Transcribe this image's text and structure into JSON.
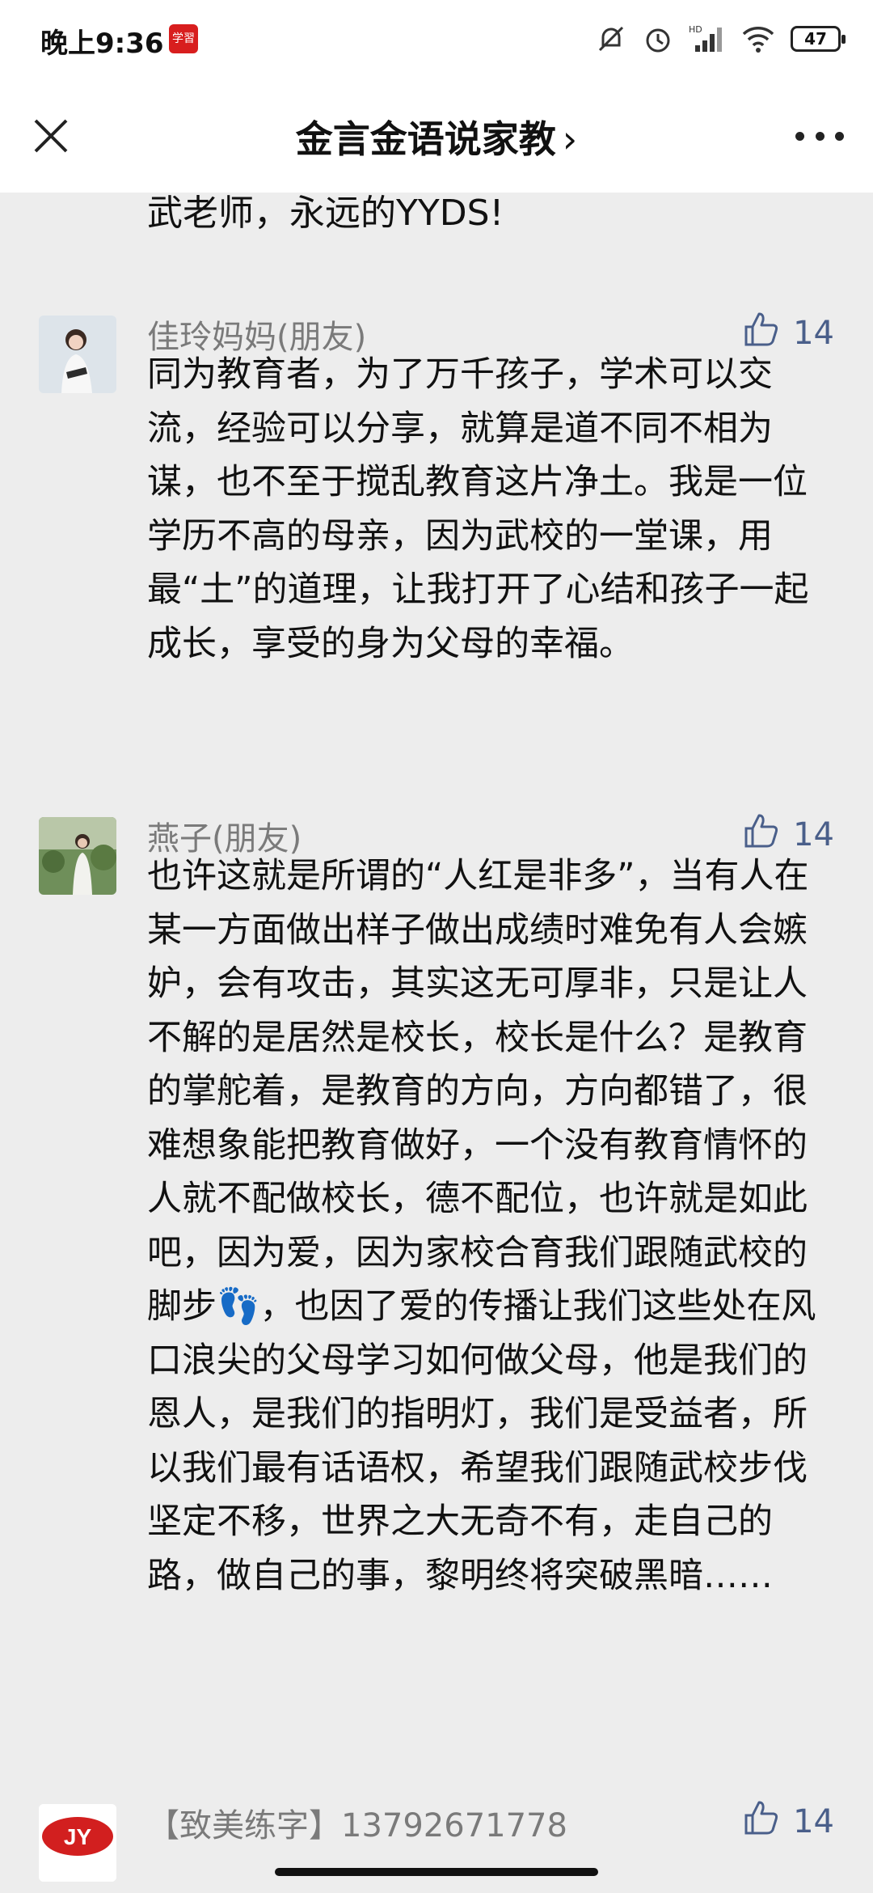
{
  "status_bar": {
    "time": "晚上9:36",
    "app_icon_label": "学習",
    "battery": "47",
    "icons": [
      "mute-icon",
      "alarm-icon",
      "hd-signal-icon",
      "wifi-icon",
      "battery-icon"
    ]
  },
  "nav": {
    "title": "金言金语说家教",
    "chevron": "›",
    "icons": [
      "close-icon",
      "more-icon"
    ]
  },
  "previous_comment_tail": "武老师，永远的YYDS!",
  "comments": [
    {
      "name": "佳玲妈妈(朋友)",
      "likes": "14",
      "text": "同为教育者，为了万千孩子，学术可以交流，经验可以分享，就算是道不同不相为谋，也不至于搅乱教育这片净土。我是一位学历不高的母亲，因为武校的一堂课，用最“土”的道理，让我打开了心结和孩子一起成长，享受的身为父母的幸福。"
    },
    {
      "name": "燕子(朋友)",
      "likes": "14",
      "text": "也许这就是所谓的“人红是非多”，当有人在某一方面做出样子做出成绩时难免有人会嫉妒，会有攻击，其实这无可厚非，只是让人不解的是居然是校长，校长是什么？是教育的掌舵着，是教育的方向，方向都错了，很难想象能把教育做好，一个没有教育情怀的人就不配做校长，德不配位，也许就是如此吧，因为爱，因为家校合育我们跟随武校的脚步👣，也因了爱的传播让我们这些处在风口浪尖的父母学习如何做父母，他是我们的恩人，是我们的指明灯，我们是受益者，所以我们最有话语权，希望我们跟随武校步伐坚定不移，世界之大无奇不有，走自己的路，做自己的事，黎明终将突破黑暗……"
    },
    {
      "name": "【致美练字】13792671778",
      "likes": "14",
      "avatar_logo_text": "JY"
    }
  ],
  "colors": {
    "background": "#ededed",
    "header": "#ffffff",
    "like_blue": "#4a5f8a",
    "name_gray": "#7a7a7a"
  }
}
